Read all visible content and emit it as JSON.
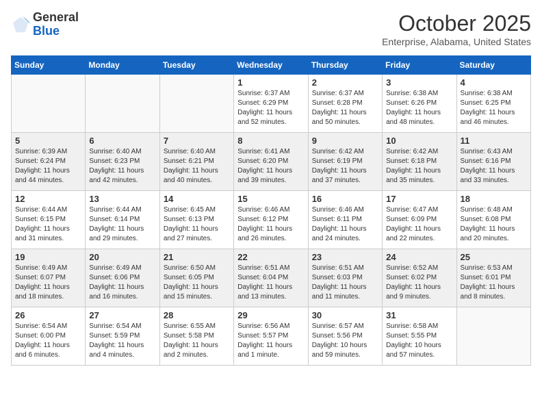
{
  "header": {
    "logo_general": "General",
    "logo_blue": "Blue",
    "month_title": "October 2025",
    "subtitle": "Enterprise, Alabama, United States"
  },
  "weekdays": [
    "Sunday",
    "Monday",
    "Tuesday",
    "Wednesday",
    "Thursday",
    "Friday",
    "Saturday"
  ],
  "weeks": [
    [
      {
        "day": "",
        "sunrise": "",
        "sunset": "",
        "daylight": "",
        "empty": true
      },
      {
        "day": "",
        "sunrise": "",
        "sunset": "",
        "daylight": "",
        "empty": true
      },
      {
        "day": "",
        "sunrise": "",
        "sunset": "",
        "daylight": "",
        "empty": true
      },
      {
        "day": "1",
        "sunrise": "Sunrise: 6:37 AM",
        "sunset": "Sunset: 6:29 PM",
        "daylight": "Daylight: 11 hours and 52 minutes.",
        "empty": false
      },
      {
        "day": "2",
        "sunrise": "Sunrise: 6:37 AM",
        "sunset": "Sunset: 6:28 PM",
        "daylight": "Daylight: 11 hours and 50 minutes.",
        "empty": false
      },
      {
        "day": "3",
        "sunrise": "Sunrise: 6:38 AM",
        "sunset": "Sunset: 6:26 PM",
        "daylight": "Daylight: 11 hours and 48 minutes.",
        "empty": false
      },
      {
        "day": "4",
        "sunrise": "Sunrise: 6:38 AM",
        "sunset": "Sunset: 6:25 PM",
        "daylight": "Daylight: 11 hours and 46 minutes.",
        "empty": false
      }
    ],
    [
      {
        "day": "5",
        "sunrise": "Sunrise: 6:39 AM",
        "sunset": "Sunset: 6:24 PM",
        "daylight": "Daylight: 11 hours and 44 minutes.",
        "empty": false
      },
      {
        "day": "6",
        "sunrise": "Sunrise: 6:40 AM",
        "sunset": "Sunset: 6:23 PM",
        "daylight": "Daylight: 11 hours and 42 minutes.",
        "empty": false
      },
      {
        "day": "7",
        "sunrise": "Sunrise: 6:40 AM",
        "sunset": "Sunset: 6:21 PM",
        "daylight": "Daylight: 11 hours and 40 minutes.",
        "empty": false
      },
      {
        "day": "8",
        "sunrise": "Sunrise: 6:41 AM",
        "sunset": "Sunset: 6:20 PM",
        "daylight": "Daylight: 11 hours and 39 minutes.",
        "empty": false
      },
      {
        "day": "9",
        "sunrise": "Sunrise: 6:42 AM",
        "sunset": "Sunset: 6:19 PM",
        "daylight": "Daylight: 11 hours and 37 minutes.",
        "empty": false
      },
      {
        "day": "10",
        "sunrise": "Sunrise: 6:42 AM",
        "sunset": "Sunset: 6:18 PM",
        "daylight": "Daylight: 11 hours and 35 minutes.",
        "empty": false
      },
      {
        "day": "11",
        "sunrise": "Sunrise: 6:43 AM",
        "sunset": "Sunset: 6:16 PM",
        "daylight": "Daylight: 11 hours and 33 minutes.",
        "empty": false
      }
    ],
    [
      {
        "day": "12",
        "sunrise": "Sunrise: 6:44 AM",
        "sunset": "Sunset: 6:15 PM",
        "daylight": "Daylight: 11 hours and 31 minutes.",
        "empty": false
      },
      {
        "day": "13",
        "sunrise": "Sunrise: 6:44 AM",
        "sunset": "Sunset: 6:14 PM",
        "daylight": "Daylight: 11 hours and 29 minutes.",
        "empty": false
      },
      {
        "day": "14",
        "sunrise": "Sunrise: 6:45 AM",
        "sunset": "Sunset: 6:13 PM",
        "daylight": "Daylight: 11 hours and 27 minutes.",
        "empty": false
      },
      {
        "day": "15",
        "sunrise": "Sunrise: 6:46 AM",
        "sunset": "Sunset: 6:12 PM",
        "daylight": "Daylight: 11 hours and 26 minutes.",
        "empty": false
      },
      {
        "day": "16",
        "sunrise": "Sunrise: 6:46 AM",
        "sunset": "Sunset: 6:11 PM",
        "daylight": "Daylight: 11 hours and 24 minutes.",
        "empty": false
      },
      {
        "day": "17",
        "sunrise": "Sunrise: 6:47 AM",
        "sunset": "Sunset: 6:09 PM",
        "daylight": "Daylight: 11 hours and 22 minutes.",
        "empty": false
      },
      {
        "day": "18",
        "sunrise": "Sunrise: 6:48 AM",
        "sunset": "Sunset: 6:08 PM",
        "daylight": "Daylight: 11 hours and 20 minutes.",
        "empty": false
      }
    ],
    [
      {
        "day": "19",
        "sunrise": "Sunrise: 6:49 AM",
        "sunset": "Sunset: 6:07 PM",
        "daylight": "Daylight: 11 hours and 18 minutes.",
        "empty": false
      },
      {
        "day": "20",
        "sunrise": "Sunrise: 6:49 AM",
        "sunset": "Sunset: 6:06 PM",
        "daylight": "Daylight: 11 hours and 16 minutes.",
        "empty": false
      },
      {
        "day": "21",
        "sunrise": "Sunrise: 6:50 AM",
        "sunset": "Sunset: 6:05 PM",
        "daylight": "Daylight: 11 hours and 15 minutes.",
        "empty": false
      },
      {
        "day": "22",
        "sunrise": "Sunrise: 6:51 AM",
        "sunset": "Sunset: 6:04 PM",
        "daylight": "Daylight: 11 hours and 13 minutes.",
        "empty": false
      },
      {
        "day": "23",
        "sunrise": "Sunrise: 6:51 AM",
        "sunset": "Sunset: 6:03 PM",
        "daylight": "Daylight: 11 hours and 11 minutes.",
        "empty": false
      },
      {
        "day": "24",
        "sunrise": "Sunrise: 6:52 AM",
        "sunset": "Sunset: 6:02 PM",
        "daylight": "Daylight: 11 hours and 9 minutes.",
        "empty": false
      },
      {
        "day": "25",
        "sunrise": "Sunrise: 6:53 AM",
        "sunset": "Sunset: 6:01 PM",
        "daylight": "Daylight: 11 hours and 8 minutes.",
        "empty": false
      }
    ],
    [
      {
        "day": "26",
        "sunrise": "Sunrise: 6:54 AM",
        "sunset": "Sunset: 6:00 PM",
        "daylight": "Daylight: 11 hours and 6 minutes.",
        "empty": false
      },
      {
        "day": "27",
        "sunrise": "Sunrise: 6:54 AM",
        "sunset": "Sunset: 5:59 PM",
        "daylight": "Daylight: 11 hours and 4 minutes.",
        "empty": false
      },
      {
        "day": "28",
        "sunrise": "Sunrise: 6:55 AM",
        "sunset": "Sunset: 5:58 PM",
        "daylight": "Daylight: 11 hours and 2 minutes.",
        "empty": false
      },
      {
        "day": "29",
        "sunrise": "Sunrise: 6:56 AM",
        "sunset": "Sunset: 5:57 PM",
        "daylight": "Daylight: 11 hours and 1 minute.",
        "empty": false
      },
      {
        "day": "30",
        "sunrise": "Sunrise: 6:57 AM",
        "sunset": "Sunset: 5:56 PM",
        "daylight": "Daylight: 10 hours and 59 minutes.",
        "empty": false
      },
      {
        "day": "31",
        "sunrise": "Sunrise: 6:58 AM",
        "sunset": "Sunset: 5:55 PM",
        "daylight": "Daylight: 10 hours and 57 minutes.",
        "empty": false
      },
      {
        "day": "",
        "sunrise": "",
        "sunset": "",
        "daylight": "",
        "empty": true
      }
    ]
  ]
}
